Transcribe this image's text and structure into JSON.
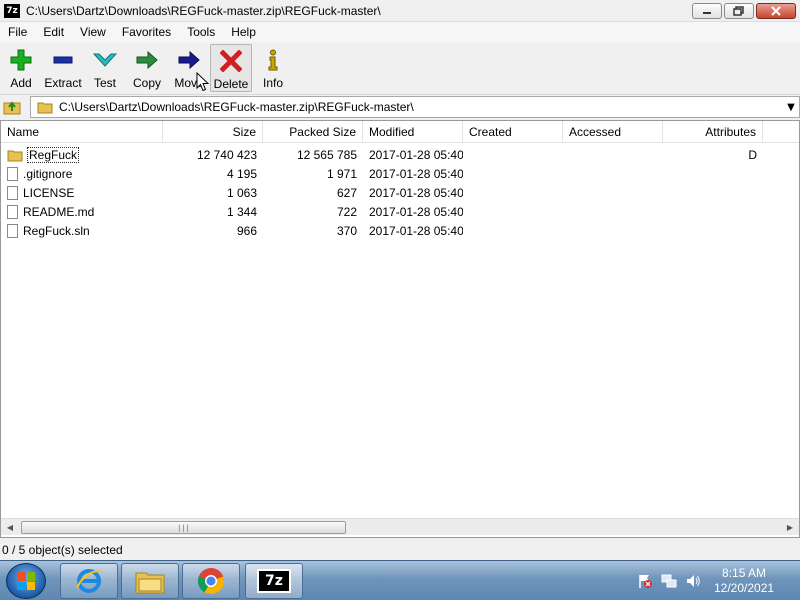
{
  "window": {
    "app_icon_text": "7z",
    "title": "C:\\Users\\Dartz\\Downloads\\REGFuck-master.zip\\REGFuck-master\\"
  },
  "menu": {
    "items": [
      "File",
      "Edit",
      "View",
      "Favorites",
      "Tools",
      "Help"
    ]
  },
  "toolbar": {
    "buttons": [
      {
        "label": "Add",
        "icon": "plus-icon",
        "color": "#16b020"
      },
      {
        "label": "Extract",
        "icon": "minus-icon",
        "color": "#1b2fa8"
      },
      {
        "label": "Test",
        "icon": "chevron-down-icon",
        "color": "#2bbbbf"
      },
      {
        "label": "Copy",
        "icon": "arrow-right-icon",
        "color": "#2b8b3f"
      },
      {
        "label": "Move",
        "icon": "arrow-right-icon",
        "color": "#1a1a8f"
      },
      {
        "label": "Delete",
        "icon": "x-icon",
        "color": "#d21e1e"
      },
      {
        "label": "Info",
        "icon": "info-icon",
        "color": "#c8a800"
      }
    ]
  },
  "address": {
    "path": "C:\\Users\\Dartz\\Downloads\\REGFuck-master.zip\\REGFuck-master\\"
  },
  "columns": [
    "Name",
    "Size",
    "Packed Size",
    "Modified",
    "Created",
    "Accessed",
    "Attributes"
  ],
  "files": [
    {
      "name": "RegFuck",
      "type": "folder",
      "size": "12 740 423",
      "packed": "12 565 785",
      "modified": "2017-01-28 05:40",
      "created": "",
      "accessed": "",
      "attributes": "D"
    },
    {
      "name": ".gitignore",
      "type": "file",
      "size": "4 195",
      "packed": "1 971",
      "modified": "2017-01-28 05:40",
      "created": "",
      "accessed": "",
      "attributes": ""
    },
    {
      "name": "LICENSE",
      "type": "file",
      "size": "1 063",
      "packed": "627",
      "modified": "2017-01-28 05:40",
      "created": "",
      "accessed": "",
      "attributes": ""
    },
    {
      "name": "README.md",
      "type": "file",
      "size": "1 344",
      "packed": "722",
      "modified": "2017-01-28 05:40",
      "created": "",
      "accessed": "",
      "attributes": ""
    },
    {
      "name": "RegFuck.sln",
      "type": "file",
      "size": "966",
      "packed": "370",
      "modified": "2017-01-28 05:40",
      "created": "",
      "accessed": "",
      "attributes": ""
    }
  ],
  "status": {
    "selection": "0 / 5 object(s) selected"
  },
  "taskbar": {
    "apps": [
      "internet-explorer-icon",
      "file-explorer-icon",
      "chrome-icon",
      "7zip-icon"
    ],
    "active_app_label": "7z",
    "time": "8:15 AM",
    "date": "12/20/2021"
  }
}
